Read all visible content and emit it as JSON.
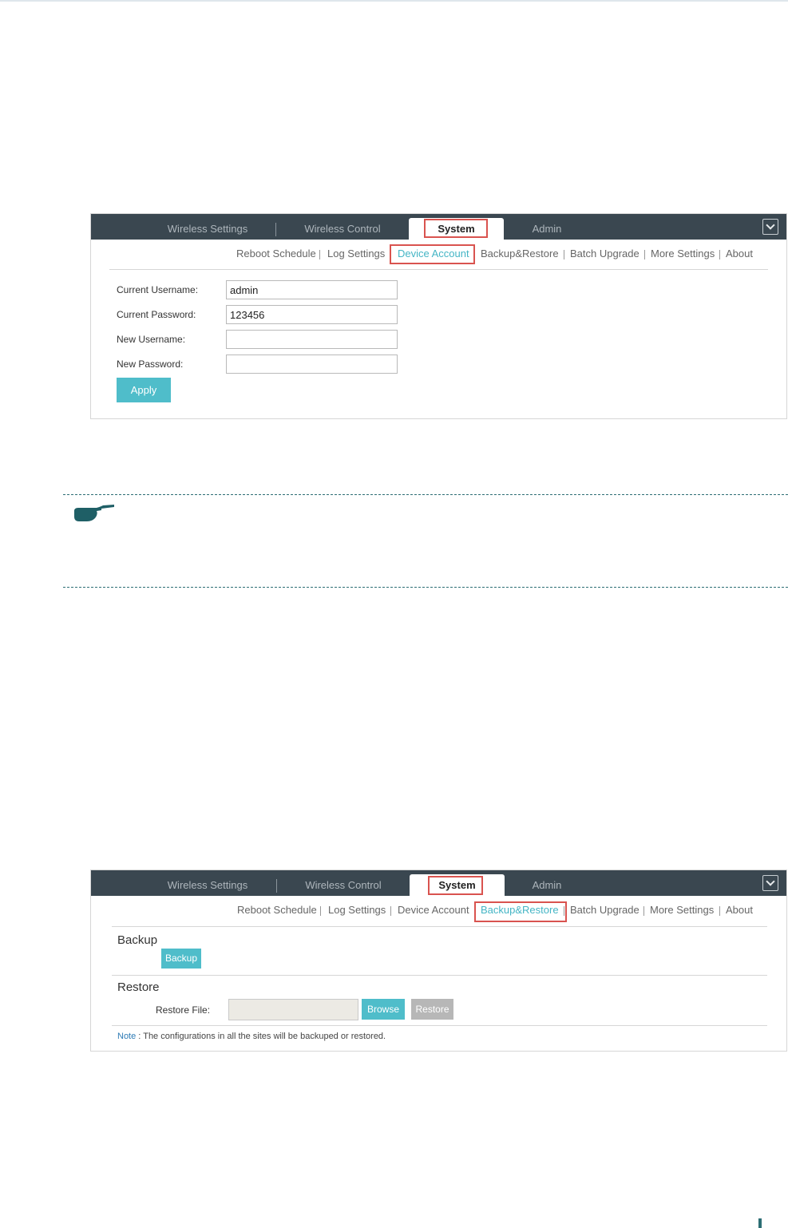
{
  "screenshot1": {
    "tabs": [
      "Wireless Settings",
      "Wireless Control",
      "System",
      "Admin"
    ],
    "active_tab": "System",
    "subnav": [
      "Reboot Schedule",
      "Log Settings",
      "Device Account",
      "Backup&Restore",
      "Batch Upgrade",
      "More Settings",
      "About"
    ],
    "active_subnav": "Device Account",
    "form": {
      "current_username_label": "Current Username:",
      "current_username_value": "admin",
      "current_password_label": "Current Password:",
      "current_password_value": "123456",
      "new_username_label": "New Username:",
      "new_username_value": "",
      "new_password_label": "New Password:",
      "new_password_value": ""
    },
    "apply_label": "Apply"
  },
  "screenshot2": {
    "tabs": [
      "Wireless Settings",
      "Wireless Control",
      "System",
      "Admin"
    ],
    "active_tab": "System",
    "subnav": [
      "Reboot Schedule",
      "Log Settings",
      "Device Account",
      "Backup&Restore",
      "Batch Upgrade",
      "More Settings",
      "About"
    ],
    "active_subnav": "Backup&Restore",
    "backup_title": "Backup",
    "backup_button": "Backup",
    "restore_title": "Restore",
    "restore_file_label": "Restore File:",
    "browse_button": "Browse",
    "restore_button": "Restore",
    "note_label": "Note",
    "note_text": " : The configurations in all the sites will be backuped or restored."
  },
  "icons": [
    "pointing-hand-icon",
    "chevron-down-icon"
  ],
  "colors": {
    "accent": "#4fbdca",
    "navbar": "#3a4750",
    "highlight_border": "#d9534f",
    "note_rule": "#2d6e74"
  }
}
